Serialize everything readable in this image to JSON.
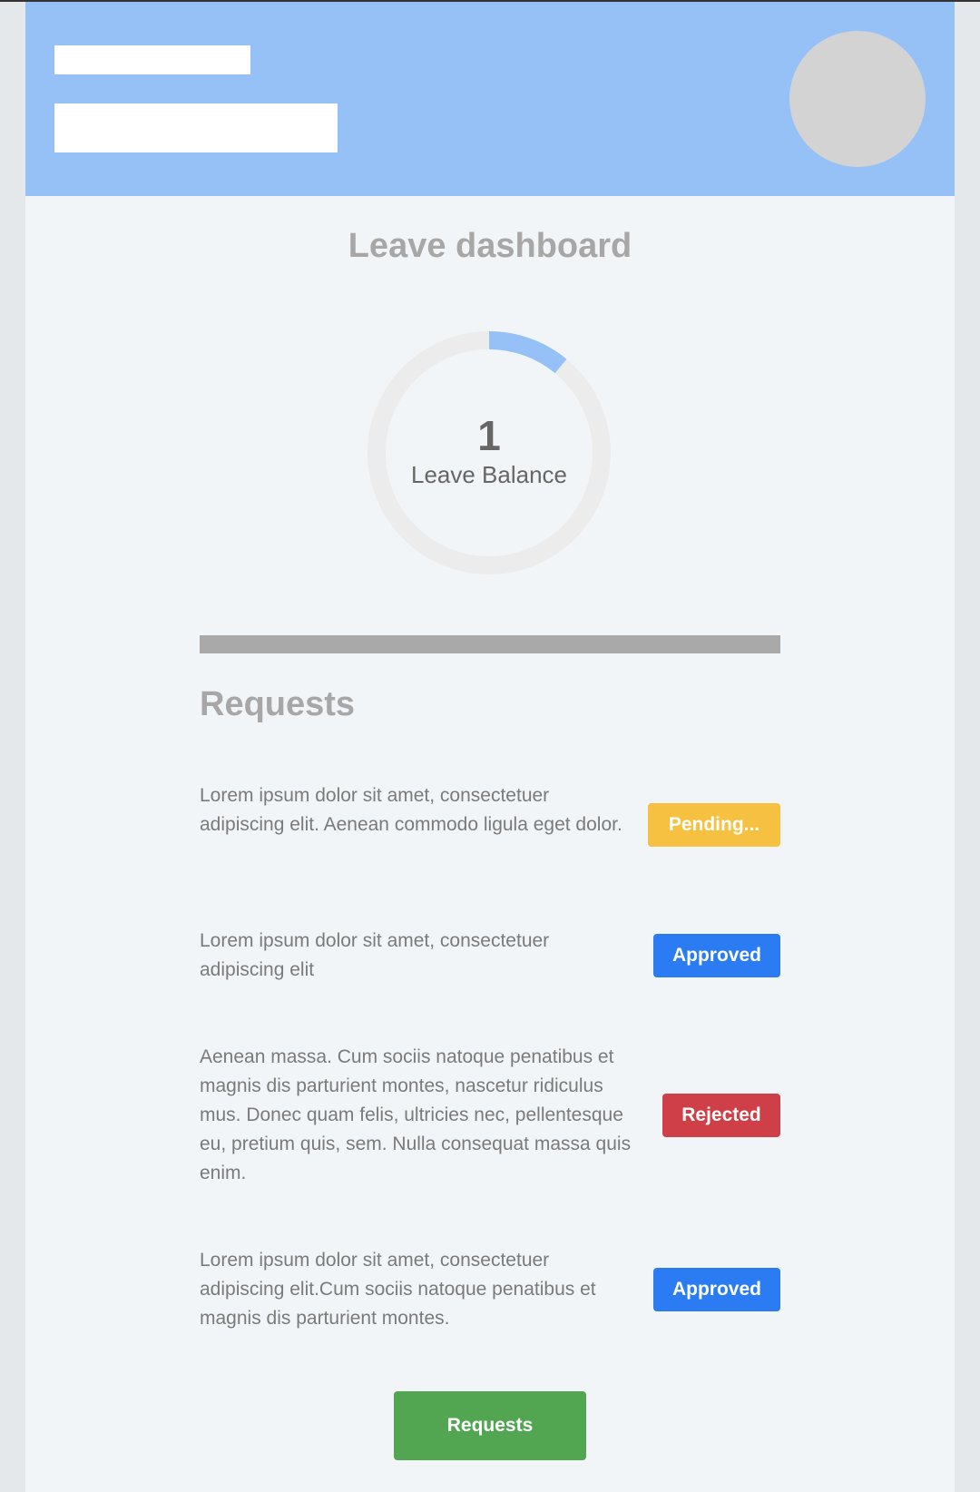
{
  "header": {
    "avatar": "user-avatar-placeholder"
  },
  "page_title": "Leave dashboard",
  "balance": {
    "value": "1",
    "label": "Leave Balance",
    "progress_fraction": 0.11,
    "track_color": "#ececec",
    "progress_color": "#96c1f7"
  },
  "requests_section": {
    "title": "Requests",
    "items": [
      {
        "text": "Lorem ipsum dolor sit amet, consectetuer adipiscing elit. Aenean commodo ligula eget dolor.",
        "status": "Pending...",
        "status_color": "#f6c140"
      },
      {
        "text": "Lorem ipsum dolor sit amet, consectetuer adipiscing elit",
        "status": "Approved",
        "status_color": "#2b7cf2"
      },
      {
        "text": "Aenean massa. Cum sociis natoque penatibus et magnis dis parturient montes, nascetur ridiculus mus. Donec quam felis, ultricies nec, pellentesque eu, pretium quis, sem. Nulla consequat massa quis enim.",
        "status": "Rejected",
        "status_color": "#cf3f47"
      },
      {
        "text": "Lorem ipsum dolor sit amet, consectetuer adipiscing elit.Cum sociis natoque penatibus et magnis dis parturient montes.",
        "status": "Approved",
        "status_color": "#2b7cf2"
      }
    ]
  },
  "cta_button": {
    "label": "Requests",
    "color": "#52a652"
  },
  "colors": {
    "header_bg": "#96c1f7",
    "page_bg": "#f2f5f8",
    "outer_bg": "#e4e8eb",
    "heading_text": "#a7a7a7",
    "body_text": "#7a7a7a"
  }
}
